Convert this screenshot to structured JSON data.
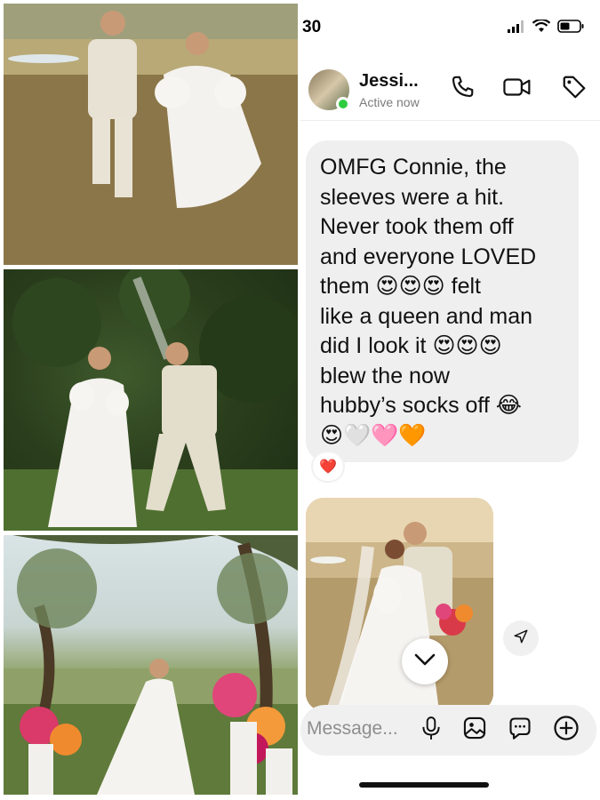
{
  "status_bar": {
    "time": "30"
  },
  "header": {
    "contact_name": "Jessi...",
    "contact_status": "Active now",
    "icons": [
      "phone-icon",
      "video-icon",
      "tag-icon"
    ]
  },
  "message": {
    "lines": [
      "OMFG Connie, the",
      "sleeves were a hit.",
      "Never took them off",
      "and everyone LOVED",
      "them 😍😍😍 felt",
      "like a queen and man",
      "did I look it 😍😍😍",
      "blew the now",
      "hubby’s socks off 😂",
      "😍🤍🩷🧡"
    ],
    "reaction": "❤️"
  },
  "composer": {
    "placeholder": "Message..."
  },
  "colors": {
    "bubble": "#efefef",
    "online": "#2ecc40",
    "text": "#111111",
    "muted": "#7b7b7b"
  }
}
